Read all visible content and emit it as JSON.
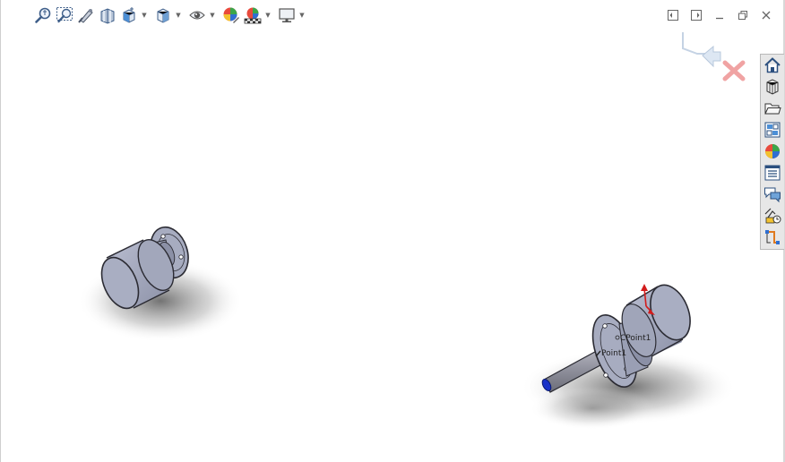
{
  "toolbar": {
    "items": [
      {
        "icon": "zoom-to-fit-icon"
      },
      {
        "icon": "zoom-to-area-icon"
      },
      {
        "icon": "previous-view-icon"
      },
      {
        "icon": "section-view-icon"
      },
      {
        "icon": "view-orientation-icon",
        "dropdown": true
      },
      {
        "icon": "display-style-icon",
        "dropdown": true
      },
      {
        "icon": "hide-show-items-icon",
        "dropdown": true
      },
      {
        "icon": "edit-appearance-icon"
      },
      {
        "icon": "apply-scene-icon",
        "dropdown": true
      },
      {
        "icon": "view-settings-icon",
        "dropdown": true
      }
    ]
  },
  "window_controls": [
    "tile-left-icon",
    "tile-right-icon",
    "minimize-icon",
    "restore-icon",
    "close-icon"
  ],
  "task_pane": {
    "tabs": [
      "solidworks-resources-icon",
      "design-library-icon",
      "file-explorer-icon",
      "view-palette-icon",
      "appearances-scenes-icon",
      "custom-properties-icon",
      "forum-icon",
      "motion-analysis-icon",
      "routing-library-icon"
    ]
  },
  "viewport": {
    "labels": {
      "point1": "Point1",
      "cpoint1": "CPoint1"
    }
  },
  "colors": {
    "part_face": "#a7acc0",
    "part_face_dark": "#8b90a6",
    "part_edge": "#2b2b33",
    "axis_red": "#d21c1c",
    "point_blue": "#1a32c8"
  }
}
